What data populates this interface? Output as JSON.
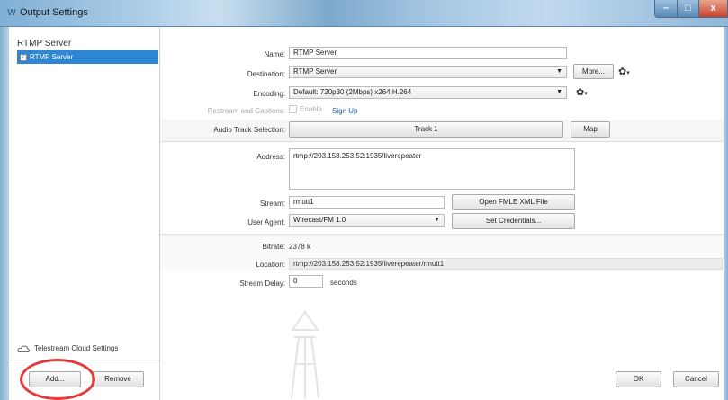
{
  "window": {
    "title": "Output Settings",
    "icon": "wirecast-icon",
    "controls": {
      "minimize": "–",
      "maximize": "□",
      "close": "x"
    }
  },
  "left": {
    "header": "RTMP Server",
    "items": [
      {
        "label": "RTMP Server",
        "checked": true
      }
    ],
    "cloud_label": "Telestream Cloud Settings",
    "add_label": "Add...",
    "remove_label": "Remove"
  },
  "form": {
    "name_label": "Name:",
    "name_value": "RTMP Server",
    "destination_label": "Destination:",
    "destination_value": "RTMP Server",
    "more_label": "More...",
    "encoding_label": "Encoding:",
    "encoding_value": "Default: 720p30 (2Mbps) x264 H.264",
    "restream_label": "Restream and Captions:",
    "enable_label": "Enable",
    "signup_label": "Sign Up",
    "audio_label": "Audio Track Selection:",
    "track_label": "Track 1",
    "map_label": "Map",
    "address_label": "Address:",
    "address_value": "rtmp://203.158.253.52:1935/liverepeater",
    "stream_label": "Stream:",
    "stream_value": "rmutt1",
    "open_fmle_label": "Open FMLE XML File",
    "user_agent_label": "User Agent:",
    "user_agent_value": "Wirecast/FM 1.0",
    "set_credentials_label": "Set Credentials...",
    "bitrate_label": "Bitrate:",
    "bitrate_value": "2378 k",
    "location_label": "Location:",
    "location_value": "rtmp://203.158.253.52:1935/liverepeater/rmutt1",
    "delay_label": "Stream Delay:",
    "delay_value": "0",
    "delay_unit": "seconds"
  },
  "footer": {
    "ok_label": "OK",
    "cancel_label": "Cancel"
  },
  "colors": {
    "selection": "#2f86d4",
    "annotation": "#e53a3a",
    "link": "#1f5fb8"
  }
}
